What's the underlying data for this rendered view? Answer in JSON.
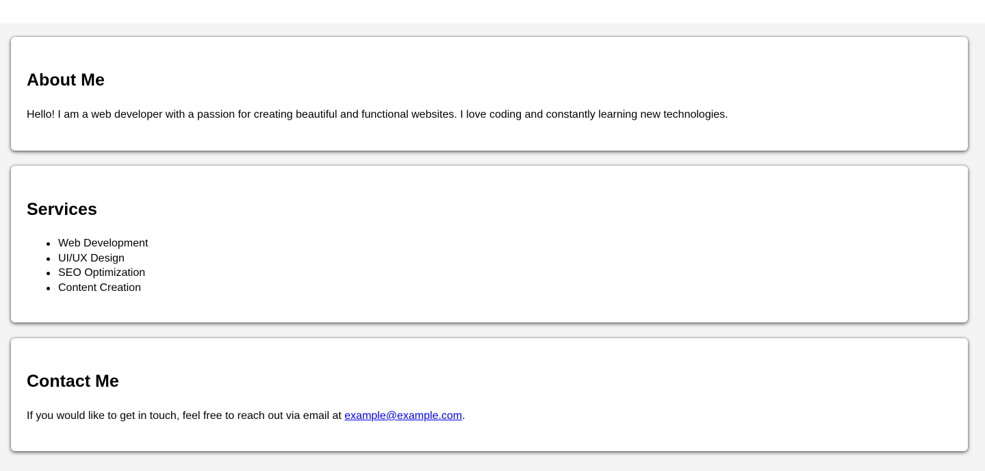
{
  "about": {
    "title": "About Me",
    "text": "Hello! I am a web developer with a passion for creating beautiful and functional websites. I love coding and constantly learning new technologies."
  },
  "services": {
    "title": "Services",
    "items": [
      "Web Development",
      "UI/UX Design",
      "SEO Optimization",
      "Content Creation"
    ]
  },
  "contact": {
    "title": "Contact Me",
    "text_before": "If you would like to get in touch, feel free to reach out via email at ",
    "email": "example@example.com",
    "text_after": "."
  },
  "colors": {
    "link": "#0000ee",
    "card_background": "#ffffff",
    "page_background": "#f4f4f4"
  }
}
